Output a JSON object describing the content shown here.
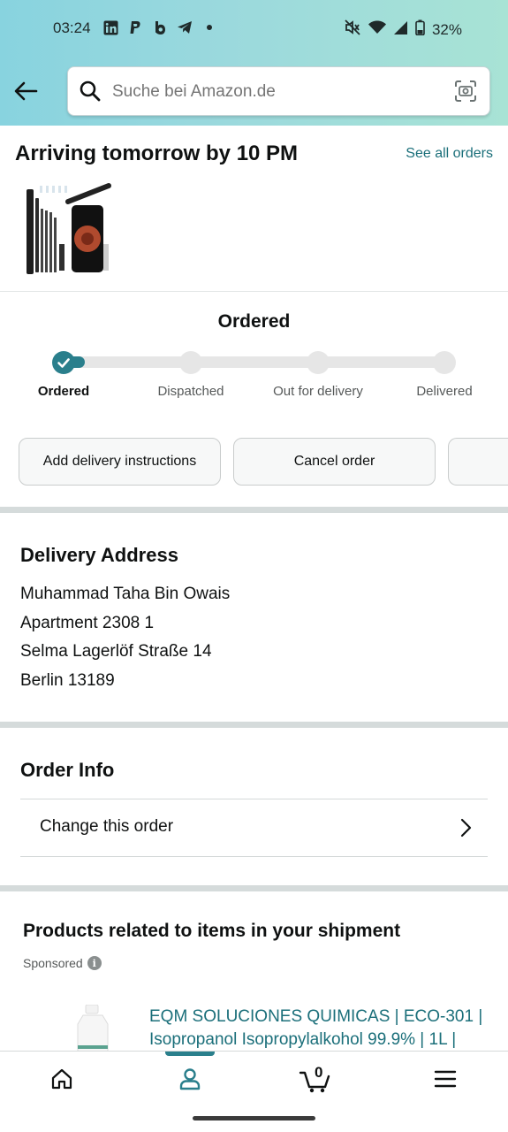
{
  "status_bar": {
    "time": "03:24",
    "app_icons": [
      "linkedin-icon",
      "paypal-icon",
      "b-icon",
      "telegram-icon",
      "dot-icon"
    ],
    "battery": "32%"
  },
  "search": {
    "placeholder": "Suche bei Amazon.de"
  },
  "delivery": {
    "headline": "Arriving tomorrow by 10 PM",
    "see_all_orders": "See all orders"
  },
  "progress": {
    "title": "Ordered",
    "steps": [
      "Ordered",
      "Dispatched",
      "Out for delivery",
      "Delivered"
    ],
    "current_step": 1
  },
  "actions": {
    "add_instructions": "Add delivery instructions",
    "cancel_order": "Cancel order"
  },
  "address": {
    "title": "Delivery Address",
    "lines": [
      "Muhammad Taha Bin Owais",
      "Apartment 2308 1",
      "Selma Lagerlöf Straße 14",
      "Berlin 13189"
    ]
  },
  "order_info": {
    "title": "Order Info",
    "change_order": "Change this order"
  },
  "related": {
    "title": "Products related to items in your shipment",
    "sponsored": "Sponsored",
    "product_title": "EQM SOLUCIONES QUIMICAS | ECO-301 | Isopropanol Isopropylalkohol 99.9% | 1L |"
  },
  "bottom_nav": {
    "cart_count": "0",
    "items": [
      "home-icon",
      "account-icon",
      "cart-icon",
      "menu-icon"
    ],
    "active": "account-icon"
  },
  "colors": {
    "accent": "#2a7f8c",
    "link": "#1b6f7a"
  }
}
